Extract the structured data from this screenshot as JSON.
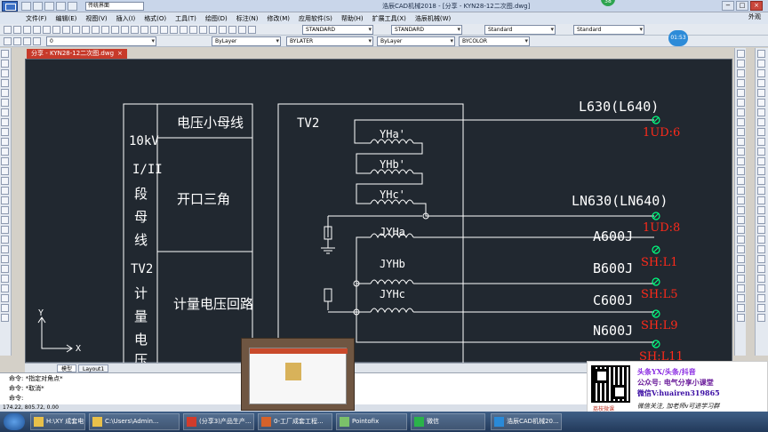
{
  "window": {
    "title": "浩辰CAD机械2018 - [分享 - KYN28-12二次图.dwg]",
    "workspace": "传统界面",
    "notification_count": "38",
    "right_label": "外观",
    "minimize": "−",
    "maximize": "□",
    "close": "×"
  },
  "menu": [
    "文件(F)",
    "编辑(E)",
    "视图(V)",
    "插入(I)",
    "格式(O)",
    "工具(T)",
    "绘图(D)",
    "标注(N)",
    "修改(M)",
    "应用软件(S)",
    "帮助(H)",
    "扩展工具(X)",
    "浩辰机械(W)"
  ],
  "toolbar2": {
    "layer": "0",
    "color": "ByLayer",
    "linetype": "BYLATER",
    "lineweight": "ByLayer",
    "plotstyle": "BYCOLOR"
  },
  "toolbar1": {
    "textstyle": "STANDARD",
    "dimstyle": "STANDARD",
    "tablestyle": "Standard",
    "mleaderstyle": "Standard"
  },
  "time_badge": "01:53",
  "document_tab": {
    "label": "分享 - KYN28-12二次图.dwg",
    "close": "×"
  },
  "drawing": {
    "left_col_labels": [
      "10kV",
      "I/II",
      "段",
      "母",
      "线",
      "TV2",
      "计",
      "量",
      "电",
      "压"
    ],
    "box_labels": [
      "电压小母线",
      "开口三角",
      "计量电压回路"
    ],
    "tv_label": "TV2",
    "coils": [
      "YHa'",
      "YHb'",
      "YHc'",
      "JYHa",
      "JYHb",
      "JYHc"
    ],
    "wire_labels": [
      "L630(L640)",
      "LN630(LN640)",
      "A600J",
      "B600J",
      "C600J",
      "N600J"
    ],
    "terminal_labels": [
      "1UD:6",
      "1UD:8",
      "SH:L1",
      "SH:L5",
      "SH:L9",
      "SH:L11"
    ],
    "ucs_y": "Y",
    "ucs_x": "X"
  },
  "layout_tabs": {
    "model": "模型",
    "layout1": "Layout1"
  },
  "command": {
    "lines": [
      "命令: *指定对角点*",
      "命令: *取消*",
      "命令:"
    ],
    "coords": "174.22, 805.72, 0.00"
  },
  "promo": {
    "brand": "荔枝微课",
    "line1": "头条YX/头条/抖音",
    "line2": "公众号: 电气分享小课堂",
    "line3": "微信V:huairen319865",
    "line4": "微信关注, 加老师v可进学习群"
  },
  "taskbar": [
    {
      "label": "H:\\XY 成套电气...",
      "icon": "folder"
    },
    {
      "label": "C:\\Users\\Admin...",
      "icon": "folder"
    },
    {
      "label": "(分享3)产品生产...",
      "icon": "pdf"
    },
    {
      "label": "0-工厂成套工程...",
      "icon": "ppt"
    },
    {
      "label": "Pointofix",
      "icon": "pen"
    },
    {
      "label": "微信",
      "icon": "wechat"
    },
    {
      "label": "浩辰CAD机械20...",
      "icon": "cad"
    }
  ],
  "colors": {
    "canvas": "#212830",
    "terminal": "#00ff80",
    "red_text": "#ff2a1a",
    "lines": "#ffffff"
  }
}
